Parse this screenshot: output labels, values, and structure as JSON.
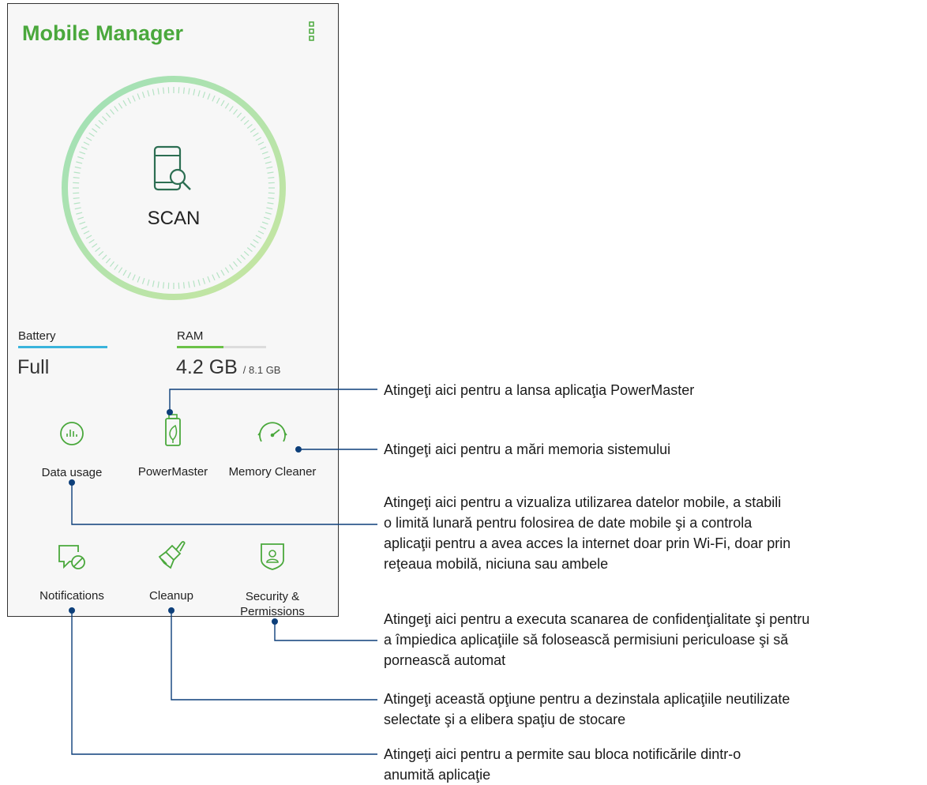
{
  "app": {
    "title": "Mobile Manager"
  },
  "scan": {
    "label": "SCAN"
  },
  "battery": {
    "label": "Battery",
    "value": "Full",
    "level": 1.0,
    "color": "#3ab4dc"
  },
  "ram": {
    "label": "RAM",
    "value": "4.2 GB",
    "total": "/ 8.1 GB",
    "level": 0.52,
    "color": "#6bc248"
  },
  "tiles": {
    "data_usage": "Data usage",
    "powermaster": "PowerMaster",
    "memory_cleaner": "Memory Cleaner",
    "notifications": "Notifications",
    "cleanup": "Cleanup",
    "security_1": "Security &",
    "security_2": "Permissions"
  },
  "callouts": {
    "powermaster": [
      "Atingeţi aici pentru a lansa aplicaţia PowerMaster"
    ],
    "memory": [
      "Atingeţi aici pentru a mări memoria sistemului"
    ],
    "data": [
      "Atingeţi aici pentru a vizualiza utilizarea datelor mobile, a stabili",
      "o limită lunară pentru folosirea de date mobile şi a controla",
      "aplicaţii pentru a avea acces la internet doar prin Wi-Fi, doar prin",
      "reţeaua mobilă, niciuna sau ambele"
    ],
    "security": [
      "Atingeţi aici pentru a executa scanarea de confidenţialitate şi pentru",
      "a împiedica aplicaţiile să folosească permisiuni periculoase şi să",
      "pornească automat"
    ],
    "cleanup": [
      "Atingeţi această opţiune pentru a dezinstala aplicaţiile neutilizate",
      "selectate şi a elibera spaţiu de stocare"
    ],
    "notifications": [
      "Atingeţi aici pentru a permite sau bloca notificările dintr-o",
      "anumită aplicaţie"
    ]
  },
  "colors": {
    "accent": "#4aa83c",
    "icon": "#2c6e52",
    "line": "#0d3f7a"
  }
}
